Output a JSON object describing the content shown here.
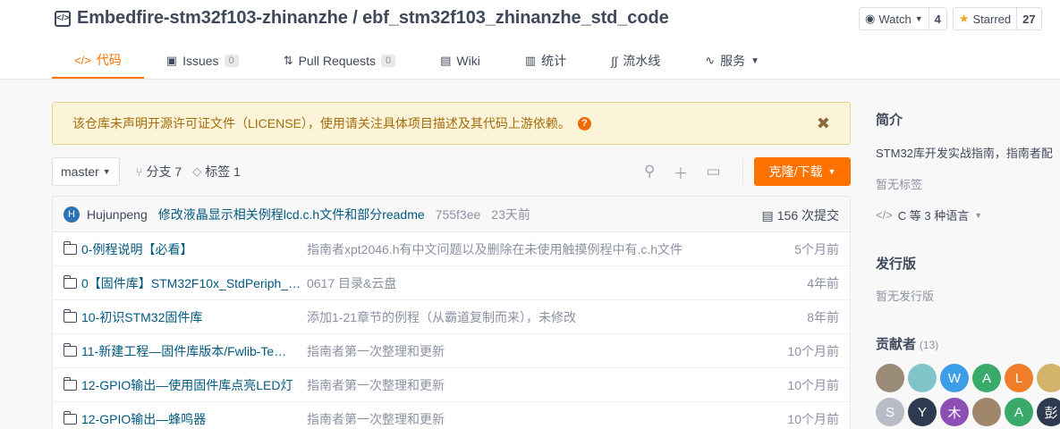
{
  "header": {
    "repo_icon": "</>",
    "repo_title": "Embedfire-stm32f103-zhinanzhe / ebf_stm32f103_zhinanzhe_std_code",
    "watch": {
      "label": "Watch",
      "count": "4"
    },
    "star": {
      "label": "Starred",
      "count": "27"
    }
  },
  "tabs": [
    {
      "icon": "</>",
      "label": "代码",
      "badge": ""
    },
    {
      "icon": "▣",
      "label": "Issues",
      "badge": "0"
    },
    {
      "icon": "⇅",
      "label": "Pull Requests",
      "badge": "0"
    },
    {
      "icon": "▤",
      "label": "Wiki",
      "badge": ""
    },
    {
      "icon": "▥",
      "label": "统计",
      "badge": ""
    },
    {
      "icon": "∫∫",
      "label": "流水线",
      "badge": ""
    },
    {
      "icon": "∿",
      "label": "服务",
      "badge": ""
    }
  ],
  "notice": {
    "text": "该仓库未声明开源许可证文件（LICENSE），使用请关注具体项目描述及其代码上游依赖。",
    "help": "?",
    "close": "✖"
  },
  "branch": {
    "current": "master",
    "branches_label": "分支 7",
    "tags_label": "标签 1",
    "clone_label": "克隆/下载"
  },
  "latest_commit": {
    "avatar_letter": "H",
    "author": "Hujunpeng",
    "message": "修改液晶显示相关例程lcd.c.h文件和部分readme",
    "sha": "755f3ee",
    "time": "23天前",
    "count_label": "156 次提交"
  },
  "files": [
    {
      "name": "0-例程说明【必看】",
      "commit": "指南者xpt2046.h有中文问题以及删除在未使用触摸例程中有.c.h文件",
      "time": "5个月前"
    },
    {
      "name": "0【固件库】STM32F10x_StdPeriph_…",
      "commit": "0617 目录&云盘",
      "time": "4年前"
    },
    {
      "name": "10-初识STM32固件库",
      "commit": "添加1-21章节的例程（从霸道复制而来），未修改",
      "time": "8年前"
    },
    {
      "name": "11-新建工程—固件库版本/Fwlib-Te…",
      "commit": "指南者第一次整理和更新",
      "time": "10个月前"
    },
    {
      "name": "12-GPIO输出—使用固件库点亮LED灯",
      "commit": "指南者第一次整理和更新",
      "time": "10个月前"
    },
    {
      "name": "12-GPIO输出—蜂鸣器",
      "commit": "指南者第一次整理和更新",
      "time": "10个月前"
    }
  ],
  "sidebar": {
    "intro_title": "简介",
    "intro_text": "STM32库开发实战指南，指南者配",
    "no_tags": "暂无标签",
    "lang_icon": "</>",
    "lang_text": "C 等 3 种语言",
    "releases_title": "发行版",
    "no_releases": "暂无发行版",
    "contributors_title": "贡献者",
    "contributors_count": "(13)",
    "avatars_row1": [
      {
        "letter": "",
        "color": "#9a8a78"
      },
      {
        "letter": "",
        "color": "#7fc4c9"
      },
      {
        "letter": "W",
        "color": "#3d9ee8"
      },
      {
        "letter": "A",
        "color": "#3aaa6b"
      },
      {
        "letter": "L",
        "color": "#ef7d2a"
      },
      {
        "letter": "",
        "color": "#d4b46a"
      }
    ],
    "avatars_row2": [
      {
        "letter": "S",
        "color": "#b8bcc6"
      },
      {
        "letter": "Y",
        "color": "#2d3a4f"
      },
      {
        "letter": "木",
        "color": "#8e4fb5"
      },
      {
        "letter": "",
        "color": "#a0866b"
      },
      {
        "letter": "A",
        "color": "#3aaa6b"
      },
      {
        "letter": "彭",
        "color": "#2d3a4f"
      }
    ]
  }
}
